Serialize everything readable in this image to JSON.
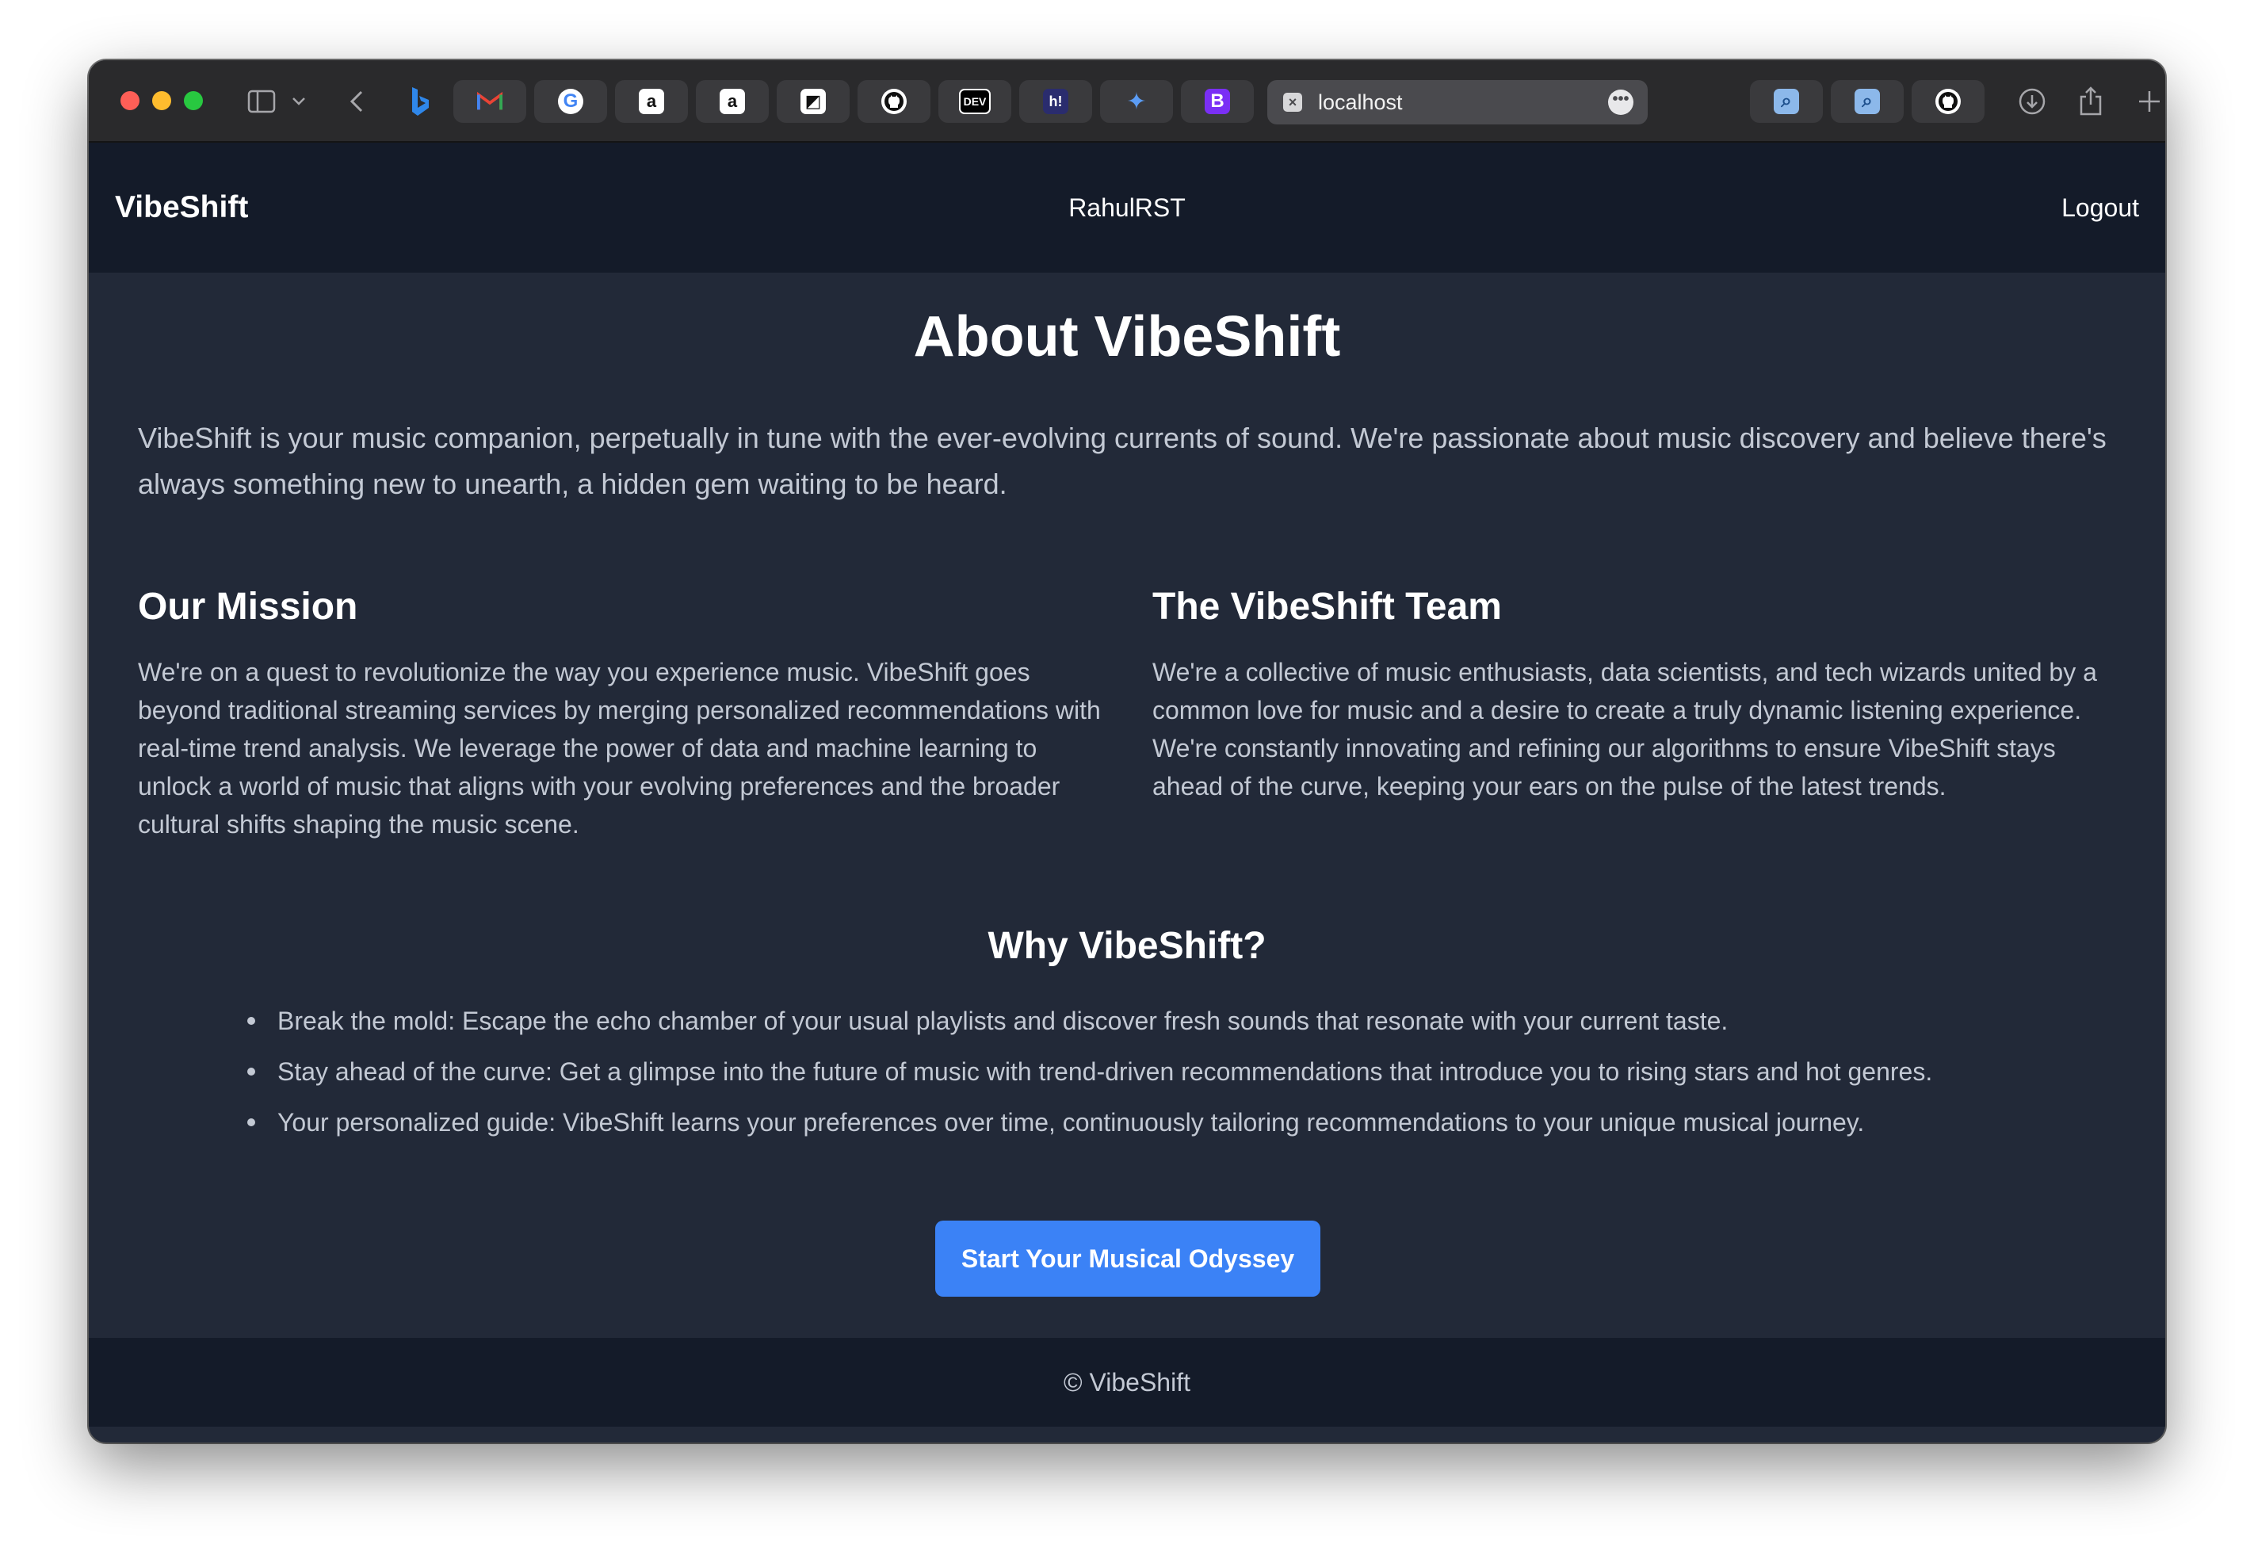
{
  "browser": {
    "url": "localhost",
    "url_favicon": "×",
    "more_glyph": "•••",
    "tabs": [
      {
        "icon": "bing-icon",
        "glyph": "b"
      },
      {
        "icon": "gmail-icon",
        "glyph": "M"
      },
      {
        "icon": "google-icon",
        "glyph": "G"
      },
      {
        "icon": "amazon-icon",
        "glyph": "a"
      },
      {
        "icon": "amazon-icon",
        "glyph": "a"
      },
      {
        "icon": "notion-icon",
        "glyph": "◩"
      },
      {
        "icon": "github-icon",
        "glyph": "◉"
      },
      {
        "icon": "dev-icon",
        "glyph": "DEV"
      },
      {
        "icon": "hashnode-icon",
        "glyph": "h!"
      },
      {
        "icon": "gemini-icon",
        "glyph": "✦"
      },
      {
        "icon": "bootstrap-icon",
        "glyph": "B"
      },
      {
        "icon": "search-icon",
        "glyph": "⌕"
      },
      {
        "icon": "search-icon",
        "glyph": "⌕"
      },
      {
        "icon": "github-icon",
        "glyph": "◉"
      }
    ]
  },
  "nav": {
    "brand": "VibeShift",
    "username": "RahulRST",
    "logout": "Logout"
  },
  "main": {
    "title": "About VibeShift",
    "intro": "VibeShift is your music companion, perpetually in tune with the ever-evolving currents of sound. We're passionate about music discovery and believe there's always something new to unearth, a hidden gem waiting to be heard.",
    "mission": {
      "heading": "Our Mission",
      "body": "We're on a quest to revolutionize the way you experience music. VibeShift goes beyond traditional streaming services by merging personalized recommendations with real-time trend analysis. We leverage the power of data and machine learning to unlock a world of music that aligns with your evolving preferences and the broader cultural shifts shaping the music scene."
    },
    "team": {
      "heading": "The VibeShift Team",
      "body": "We're a collective of music enthusiasts, data scientists, and tech wizards united by a common love for music and a desire to create a truly dynamic listening experience. We're constantly innovating and refining our algorithms to ensure VibeShift stays ahead of the curve, keeping your ears on the pulse of the latest trends."
    },
    "why": {
      "heading": "Why VibeShift?",
      "items": [
        "Break the mold: Escape the echo chamber of your usual playlists and discover fresh sounds that resonate with your current taste.",
        "Stay ahead of the curve: Get a glimpse into the future of music with trend-driven recommendations that introduce you to rising stars and hot genres.",
        "Your personalized guide: VibeShift learns your preferences over time, continuously tailoring recommendations to your unique musical journey."
      ]
    },
    "cta": "Start Your Musical Odyssey"
  },
  "footer": {
    "text": "© VibeShift"
  },
  "colors": {
    "accent": "#3b82f6",
    "page_bg": "#222938",
    "nav_bg": "#141b29"
  }
}
